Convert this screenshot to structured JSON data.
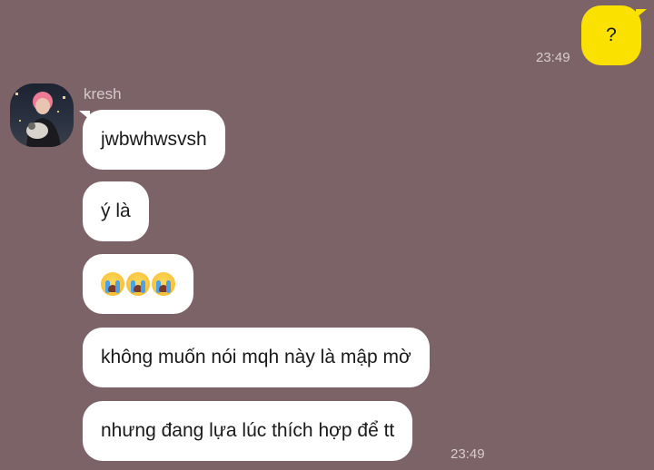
{
  "outgoing": {
    "text": "?",
    "time": "23:49"
  },
  "sender": {
    "name": "kresh"
  },
  "messages": [
    {
      "text": "jwbwhwsvsh"
    },
    {
      "text": "ý là"
    },
    {
      "emoji": [
        "loudly-crying-face",
        "loudly-crying-face",
        "loudly-crying-face"
      ]
    },
    {
      "text": "không muốn nói mqh này là mập mờ"
    },
    {
      "text": "nhưng đang lựa lúc thích hợp để tt"
    }
  ],
  "incoming_time": "23:49",
  "colors": {
    "background": "#7b6367",
    "outgoing_bubble": "#fae100",
    "incoming_bubble": "#ffffff"
  }
}
